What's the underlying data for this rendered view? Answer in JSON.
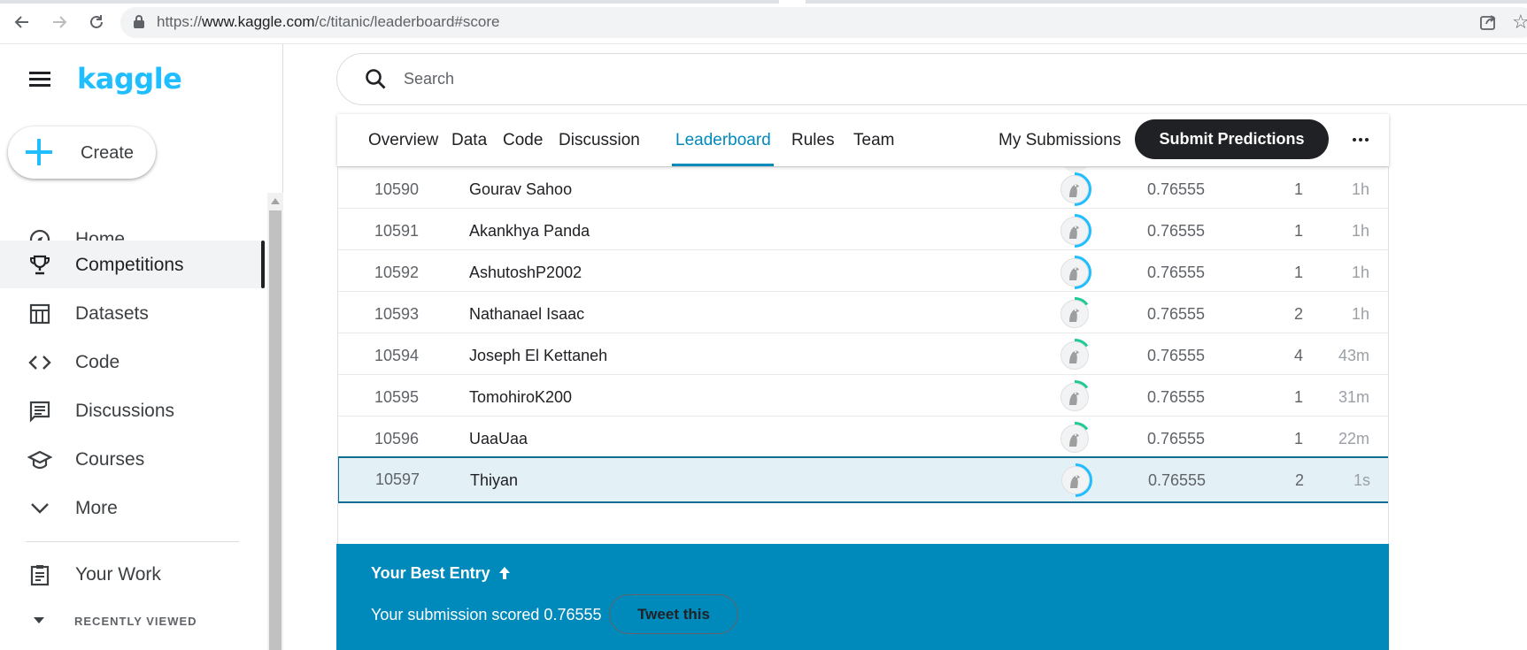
{
  "browser": {
    "url_prefix": "https://",
    "url_host": "www.kaggle.com",
    "url_path": "/c/titanic/leaderboard#score"
  },
  "sidebar": {
    "logo": "kaggle",
    "create_label": "Create",
    "items": [
      {
        "label": "Home",
        "icon": "compass-icon"
      },
      {
        "label": "Competitions",
        "icon": "trophy-icon"
      },
      {
        "label": "Datasets",
        "icon": "table-icon"
      },
      {
        "label": "Code",
        "icon": "code-icon"
      },
      {
        "label": "Discussions",
        "icon": "comment-icon"
      },
      {
        "label": "Courses",
        "icon": "school-icon"
      },
      {
        "label": "More",
        "icon": "chevron-down-icon"
      }
    ],
    "your_work": "Your Work",
    "recently_viewed": "RECENTLY VIEWED"
  },
  "search": {
    "placeholder": "Search"
  },
  "tabs": {
    "items": [
      "Overview",
      "Data",
      "Code",
      "Discussion",
      "Leaderboard",
      "Rules",
      "Team"
    ],
    "active": "Leaderboard",
    "my_submissions": "My Submissions",
    "submit": "Submit Predictions"
  },
  "leaderboard": {
    "rows": [
      {
        "rank": "10590",
        "name": "Gourav Sahoo",
        "score": "0.76555",
        "entries": "1",
        "last": "1h",
        "tier_color": "#20beff"
      },
      {
        "rank": "10591",
        "name": "Akankhya Panda",
        "score": "0.76555",
        "entries": "1",
        "last": "1h",
        "tier_color": "#20beff"
      },
      {
        "rank": "10592",
        "name": "AshutoshP2002",
        "score": "0.76555",
        "entries": "1",
        "last": "1h",
        "tier_color": "#20beff"
      },
      {
        "rank": "10593",
        "name": "Nathanael Isaac",
        "score": "0.76555",
        "entries": "2",
        "last": "1h",
        "tier_color": "#20c997"
      },
      {
        "rank": "10594",
        "name": "Joseph El Kettaneh",
        "score": "0.76555",
        "entries": "4",
        "last": "43m",
        "tier_color": "#20c997"
      },
      {
        "rank": "10595",
        "name": "TomohiroK200",
        "score": "0.76555",
        "entries": "1",
        "last": "31m",
        "tier_color": "#20c997"
      },
      {
        "rank": "10596",
        "name": "UaaUaa",
        "score": "0.76555",
        "entries": "1",
        "last": "22m",
        "tier_color": "#20c997"
      },
      {
        "rank": "10597",
        "name": "Thiyan",
        "score": "0.76555",
        "entries": "2",
        "last": "1s",
        "tier_color": "#20beff"
      }
    ]
  },
  "best_entry": {
    "title": "Your Best Entry",
    "message": "Your submission scored 0.76555",
    "tweet": "Tweet this"
  }
}
